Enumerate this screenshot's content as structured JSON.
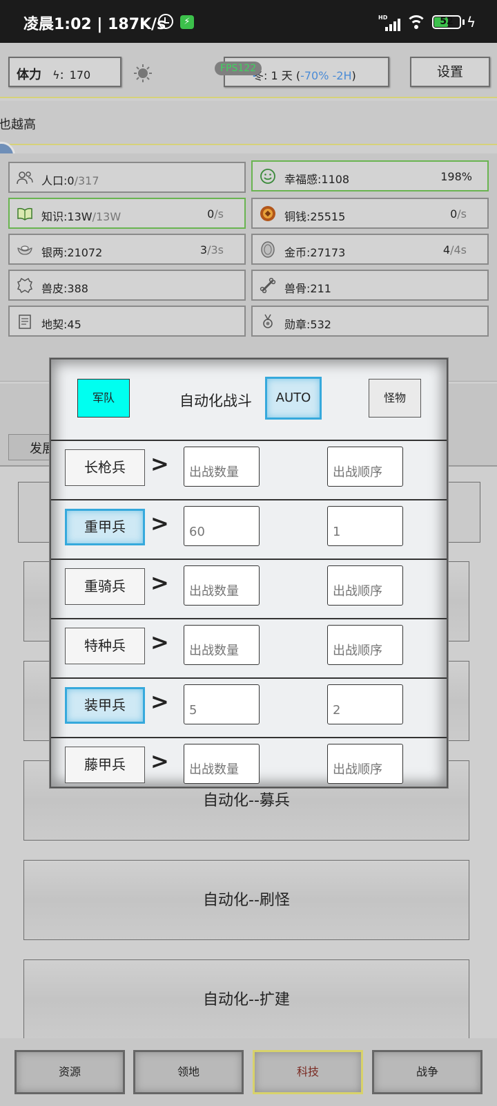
{
  "status_bar": {
    "time_speed": "凌晨1:02 | 187K/s",
    "network": "HD",
    "battery": "52",
    "battery_level": 0.52
  },
  "topbar": {
    "stamina_label": "体力",
    "stamina_sep": ":",
    "stamina_value": "170",
    "fps": "FPS122",
    "season_prefix": "冬: 1 天 (",
    "season_effect": "-70% -2H",
    "season_suffix": ")",
    "settings_label": "设置"
  },
  "notice_text": "也越高",
  "resources": [
    {
      "icon": "people-icon",
      "name": "人口:0",
      "sub": "/317",
      "rate": "",
      "rate_sub": "",
      "pct": ""
    },
    {
      "icon": "smile-icon",
      "name": "幸福感:1108",
      "sub": "",
      "rate": "",
      "rate_sub": "",
      "pct": "198%"
    },
    {
      "icon": "book-icon",
      "name": "知识:13W",
      "sub": "/13W",
      "rate": "0",
      "rate_sub": "/s",
      "pct": ""
    },
    {
      "icon": "copper-coin-icon",
      "name": "铜钱:25515",
      "sub": "",
      "rate": "0",
      "rate_sub": "/s",
      "pct": ""
    },
    {
      "icon": "silver-ingot-icon",
      "name": "银两:21072",
      "sub": "",
      "rate": "3",
      "rate_sub": "/3s",
      "pct": ""
    },
    {
      "icon": "gold-coin-icon",
      "name": "金币:27173",
      "sub": "",
      "rate": "4",
      "rate_sub": "/4s",
      "pct": ""
    },
    {
      "icon": "hide-icon",
      "name": "兽皮:388",
      "sub": "",
      "rate": "",
      "rate_sub": "",
      "pct": ""
    },
    {
      "icon": "bone-icon",
      "name": "兽骨:211",
      "sub": "",
      "rate": "",
      "rate_sub": "",
      "pct": ""
    },
    {
      "icon": "deed-icon",
      "name": "地契:45",
      "sub": "",
      "rate": "",
      "rate_sub": "",
      "pct": ""
    },
    {
      "icon": "medal-icon",
      "name": "勋章:532",
      "sub": "",
      "rate": "",
      "rate_sub": "",
      "pct": ""
    }
  ],
  "background": {
    "tab_label": "发展",
    "panels": [
      "自动化--募兵",
      "自动化--刷怪",
      "自动化--扩建"
    ]
  },
  "bottom_nav": [
    "资源",
    "领地",
    "科技",
    "战争"
  ],
  "modal": {
    "army_label": "军队",
    "title": "自动化战斗",
    "auto_label": "AUTO",
    "monster_label": "怪物",
    "arrow": ">",
    "qty_placeholder": "出战数量",
    "order_placeholder": "出战顺序",
    "units": [
      {
        "name": "长枪兵",
        "selected": false,
        "qty": "",
        "order": ""
      },
      {
        "name": "重甲兵",
        "selected": true,
        "qty": "60",
        "order": "1"
      },
      {
        "name": "重骑兵",
        "selected": false,
        "qty": "",
        "order": ""
      },
      {
        "name": "特种兵",
        "selected": false,
        "qty": "",
        "order": ""
      },
      {
        "name": "装甲兵",
        "selected": true,
        "qty": "5",
        "order": "2"
      },
      {
        "name": "藤甲兵",
        "selected": false,
        "qty": "",
        "order": ""
      }
    ]
  }
}
